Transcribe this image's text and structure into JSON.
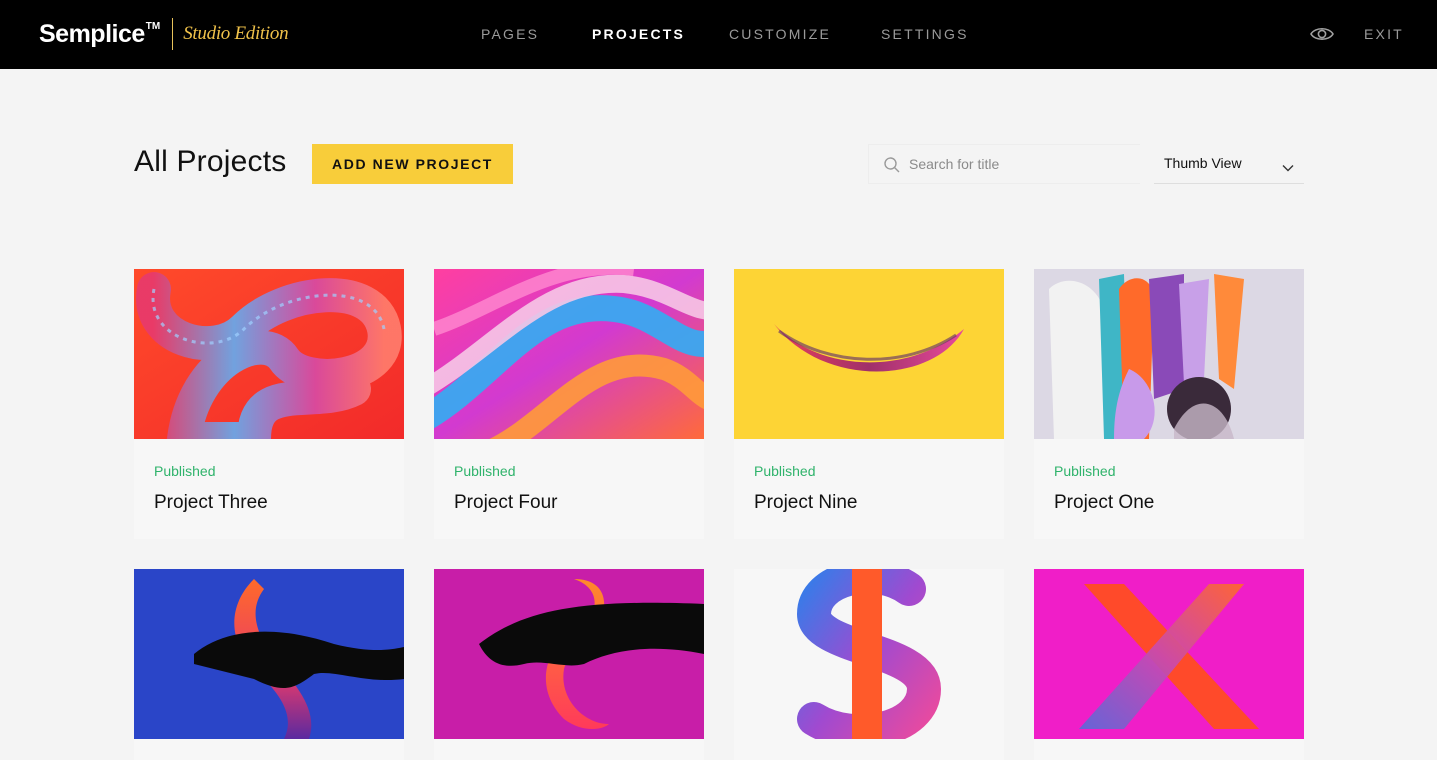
{
  "brand": {
    "name": "Semplice",
    "tm": "TM",
    "edition": "Studio Edition"
  },
  "nav": {
    "items": [
      {
        "label": "PAGES"
      },
      {
        "label": "PROJECTS"
      },
      {
        "label": "CUSTOMIZE"
      },
      {
        "label": "SETTINGS"
      }
    ],
    "active": "PROJECTS",
    "exit_label": "EXIT",
    "preview_icon": "eye-icon"
  },
  "header": {
    "title": "All Projects",
    "add_button_label": "ADD NEW PROJECT",
    "search": {
      "placeholder": "Search for title",
      "value": "",
      "icon": "search-icon"
    },
    "view_select": {
      "selected": "Thumb View",
      "icon": "chevron-down-icon"
    }
  },
  "projects": [
    {
      "status": "Published",
      "title": "Project Three"
    },
    {
      "status": "Published",
      "title": "Project Four"
    },
    {
      "status": "Published",
      "title": "Project Nine"
    },
    {
      "status": "Published",
      "title": "Project One"
    },
    {
      "status": "",
      "title": ""
    },
    {
      "status": "",
      "title": ""
    },
    {
      "status": "",
      "title": ""
    },
    {
      "status": "",
      "title": ""
    }
  ],
  "colors": {
    "accent": "#f8cd3a",
    "published": "#2fb36b",
    "topbar": "#000000",
    "edition": "#f0c24a"
  }
}
